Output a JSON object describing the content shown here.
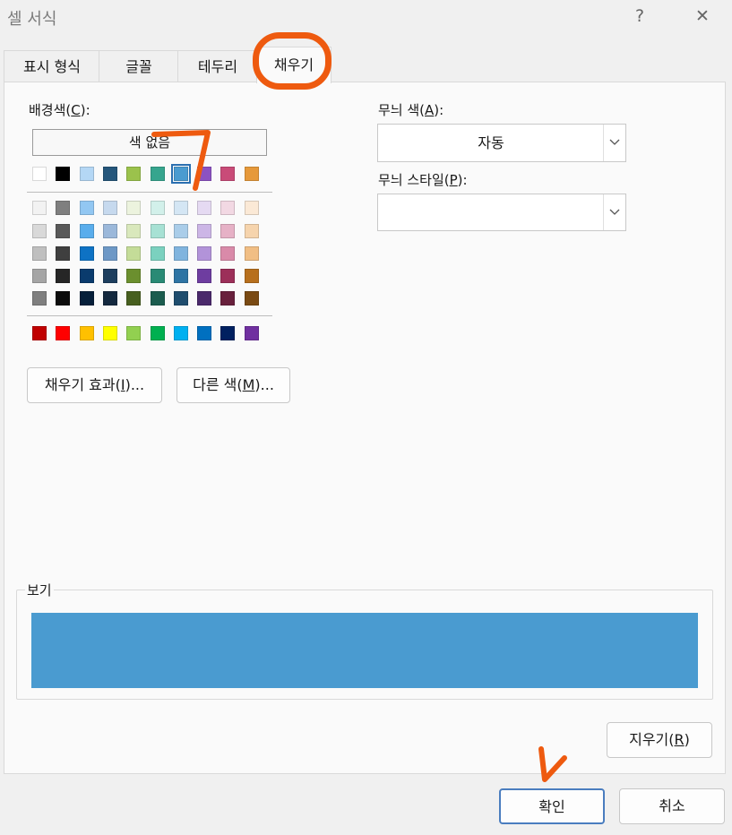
{
  "window": {
    "title": "셀 서식",
    "help_label": "?",
    "close_label": "✕"
  },
  "tabs": [
    {
      "label": "표시 형식",
      "active": false
    },
    {
      "label": "글꼴",
      "active": false
    },
    {
      "label": "테두리",
      "active": false
    },
    {
      "label": "채우기",
      "active": true
    }
  ],
  "background": {
    "label_text": "배경색(",
    "label_key": "C",
    "label_end": "):",
    "no_color": "색 없음",
    "theme_top_row": [
      "#ffffff",
      "#000000",
      "#b4d7f5",
      "#25567b",
      "#9bc24c",
      "#36a58e",
      "#4a9bd0",
      "#8c52c2",
      "#c94b78",
      "#e6993a"
    ],
    "tint_rows": [
      [
        "#f2f2f2",
        "#7f7f7f",
        "#92c7f2",
        "#c6d9ee",
        "#ecf3de",
        "#d2f0ea",
        "#d4e6f4",
        "#e5daf2",
        "#f2d8e3",
        "#fbe9d6"
      ],
      [
        "#d9d9d9",
        "#595959",
        "#59adec",
        "#9bb8da",
        "#d9e8bc",
        "#a7e1d4",
        "#aacde9",
        "#ccb6e6",
        "#e6b1c6",
        "#f6d4ad"
      ],
      [
        "#bfbfbf",
        "#3f3f3f",
        "#0e72c4",
        "#6d98c6",
        "#c4dc98",
        "#7bd1bf",
        "#80b4de",
        "#b293d9",
        "#d98aa9",
        "#f1be84"
      ],
      [
        "#a5a5a5",
        "#262626",
        "#0a3b6d",
        "#1d3e5e",
        "#6b8f2e",
        "#298a75",
        "#2e74a4",
        "#6e3da0",
        "#9c2f59",
        "#b76f1d"
      ],
      [
        "#7f7f7f",
        "#0c0c0c",
        "#061f3a",
        "#14293f",
        "#475f1f",
        "#1b5c4e",
        "#1f4d6e",
        "#4a296b",
        "#68203c",
        "#7a4a13"
      ]
    ],
    "standard_row": [
      "#c00000",
      "#ff0000",
      "#ffc000",
      "#ffff00",
      "#92d050",
      "#00b050",
      "#00b0f0",
      "#0070c0",
      "#002060",
      "#7030a0"
    ],
    "selected_color": "#4a9bd0",
    "fill_effects_label": "채우기 효과(",
    "fill_effects_key": "I",
    "fill_effects_end": ")...",
    "more_colors_label": "다른 색(",
    "more_colors_key": "M",
    "more_colors_end": ")..."
  },
  "pattern": {
    "color_label": "무늬 색(",
    "color_key": "A",
    "color_end": "):",
    "color_value": "자동",
    "style_label": "무늬 스타일(",
    "style_key": "P",
    "style_end": "):",
    "style_value": ""
  },
  "sample": {
    "label": "보기",
    "color": "#4a9bd0"
  },
  "clear_button": {
    "label": "지우기(",
    "key": "R",
    "end": ")"
  },
  "footer": {
    "ok_label": "확인",
    "cancel_label": "취소"
  },
  "annotation_color": "#ee5a0f"
}
